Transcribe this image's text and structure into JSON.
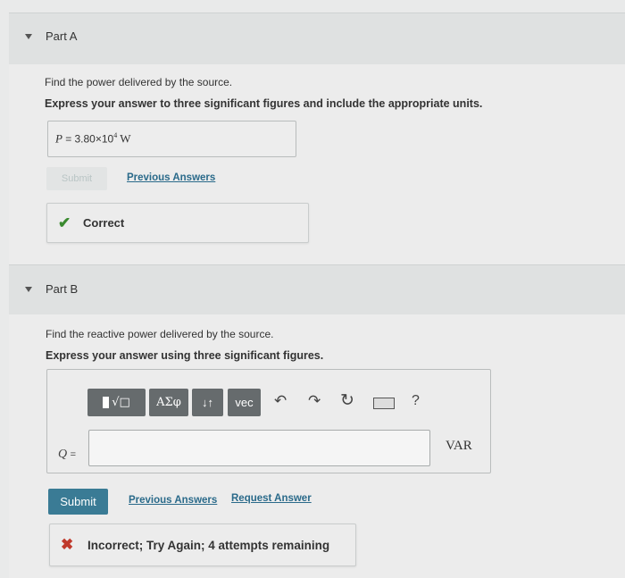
{
  "partA": {
    "title": "Part A",
    "question": "Find the power delivered by the source.",
    "instruction": "Express your answer to three significant figures and include the appropriate units.",
    "answer": {
      "var": "P",
      "equals": "=",
      "value": "3.80×10",
      "exponent": "4",
      "unit": "W"
    },
    "submit_label": "Submit",
    "previous_answers_label": "Previous Answers",
    "feedback": {
      "icon": "checkmark-icon",
      "text": "Correct",
      "color": "#3a8a2f"
    }
  },
  "partB": {
    "title": "Part B",
    "question": "Find the reactive power delivered by the source.",
    "instruction": "Express your answer using three significant figures.",
    "toolbar": {
      "templates_label": "√□",
      "greek_label": "ΑΣφ",
      "arrows_label": "↓↑",
      "vec_label": "vec",
      "undo_icon": "undo-icon",
      "redo_icon": "redo-icon",
      "reset_icon": "reset-icon",
      "keyboard_icon": "keyboard-icon",
      "help_label": "?"
    },
    "input": {
      "var": "Q",
      "equals": "=",
      "value": ""
    },
    "unit": "VAR",
    "submit_label": "Submit",
    "previous_answers_label": "Previous Answers",
    "request_answer_label": "Request Answer",
    "feedback": {
      "icon": "x-icon",
      "text": "Incorrect; Try Again; 4 attempts remaining",
      "color": "#c0392b"
    }
  }
}
